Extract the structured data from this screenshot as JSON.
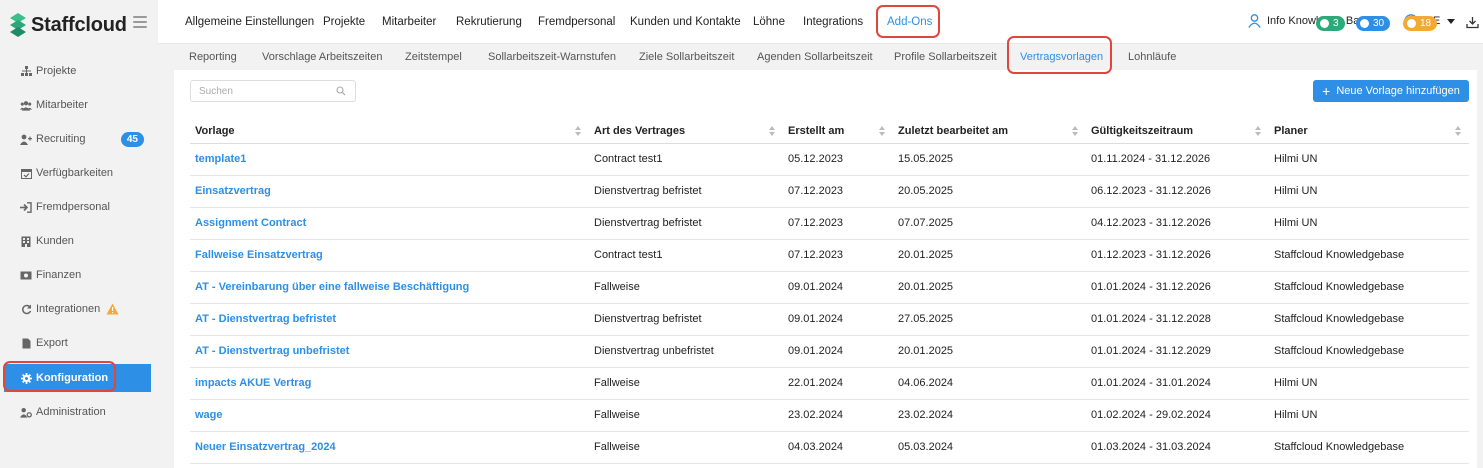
{
  "app": {
    "name": "Staffcloud"
  },
  "sidebar": {
    "items": [
      {
        "label": "Projekte",
        "icon": "sitemap-icon"
      },
      {
        "label": "Mitarbeiter",
        "icon": "users-icon"
      },
      {
        "label": "Recruiting",
        "icon": "user-plus-icon",
        "badge": "45"
      },
      {
        "label": "Verfügbarkeiten",
        "icon": "calendar-check-icon"
      },
      {
        "label": "Fremdpersonal",
        "icon": "sign-in-icon"
      },
      {
        "label": "Kunden",
        "icon": "building-icon"
      },
      {
        "label": "Finanzen",
        "icon": "money-icon"
      },
      {
        "label": "Integrationen",
        "icon": "refresh-icon",
        "warning": true
      },
      {
        "label": "Export",
        "icon": "file-icon"
      },
      {
        "label": "Konfiguration",
        "icon": "gear-icon",
        "active": true
      },
      {
        "label": "Administration",
        "icon": "user-gear-icon"
      }
    ]
  },
  "topnav": {
    "items": [
      "Allgemeine Einstellungen",
      "Projekte",
      "Mitarbeiter",
      "Rekrutierung",
      "Fremdpersonal",
      "Kunden und Kontakte",
      "Löhne",
      "Integrations",
      "Add-Ons"
    ],
    "active": "Add-Ons"
  },
  "user": {
    "name": "Info Knowledge Base"
  },
  "language": {
    "code": "DE"
  },
  "counters": {
    "messages": "3",
    "notifications": "30",
    "timers": "18"
  },
  "colors": {
    "accent": "#2d8fe5",
    "green": "#2eaa7a",
    "orange": "#f4a836",
    "highlight": "#e0463c"
  },
  "subnav": {
    "items": [
      "Reporting",
      "Vorschlage Arbeitszeiten",
      "Zeitstempel",
      "Sollarbeitszeit-Warnstufen",
      "Ziele Sollarbeitszeit",
      "Agenden Sollarbeitszeit",
      "Profile Sollarbeitszeit",
      "Vertragsvorlagen",
      "Lohnläufe"
    ],
    "active": "Vertragsvorlagen"
  },
  "search": {
    "placeholder": "Suchen",
    "value": ""
  },
  "add_button": {
    "label": "Neue Vorlage hinzufügen"
  },
  "table": {
    "columns": [
      "Vorlage",
      "Art des Vertrages",
      "Erstellt am",
      "Zuletzt bearbeitet am",
      "Gültigkeitszeitraum",
      "Planer"
    ],
    "rows": [
      [
        "template1",
        "Contract test1",
        "05.12.2023",
        "15.05.2025",
        "01.11.2024 - 31.12.2026",
        "Hilmi UN"
      ],
      [
        "Einsatzvertrag",
        "Dienstvertrag befristet",
        "07.12.2023",
        "20.05.2025",
        "06.12.2023 - 31.12.2026",
        "Hilmi UN"
      ],
      [
        "Assignment Contract",
        "Dienstvertrag befristet",
        "07.12.2023",
        "07.07.2025",
        "04.12.2023 - 31.12.2026",
        "Hilmi UN"
      ],
      [
        "Fallweise Einsatzvertrag",
        "Contract test1",
        "07.12.2023",
        "20.01.2025",
        "01.12.2023 - 31.12.2026",
        "Staffcloud Knowledgebase"
      ],
      [
        "AT - Vereinbarung über eine fallweise Beschäftigung",
        "Fallweise",
        "09.01.2024",
        "20.01.2025",
        "01.01.2024 - 31.12.2026",
        "Staffcloud Knowledgebase"
      ],
      [
        "AT - Dienstvertrag befristet",
        "Dienstvertrag befristet",
        "09.01.2024",
        "27.05.2025",
        "01.01.2024 - 31.12.2028",
        "Staffcloud Knowledgebase"
      ],
      [
        "AT - Dienstvertrag unbefristet",
        "Dienstvertrag unbefristet",
        "09.01.2024",
        "20.01.2025",
        "01.01.2024 - 31.12.2029",
        "Staffcloud Knowledgebase"
      ],
      [
        "impacts AKUE Vertrag",
        "Fallweise",
        "22.01.2024",
        "04.06.2024",
        "01.01.2024 - 31.01.2024",
        "Hilmi UN"
      ],
      [
        "wage",
        "Fallweise",
        "23.02.2024",
        "23.02.2024",
        "01.02.2024 - 29.02.2024",
        "Hilmi UN"
      ],
      [
        "Neuer Einsatzvertrag_2024",
        "Fallweise",
        "04.03.2024",
        "05.03.2024",
        "01.03.2024 - 31.03.2024",
        "Staffcloud Knowledgebase"
      ]
    ]
  }
}
